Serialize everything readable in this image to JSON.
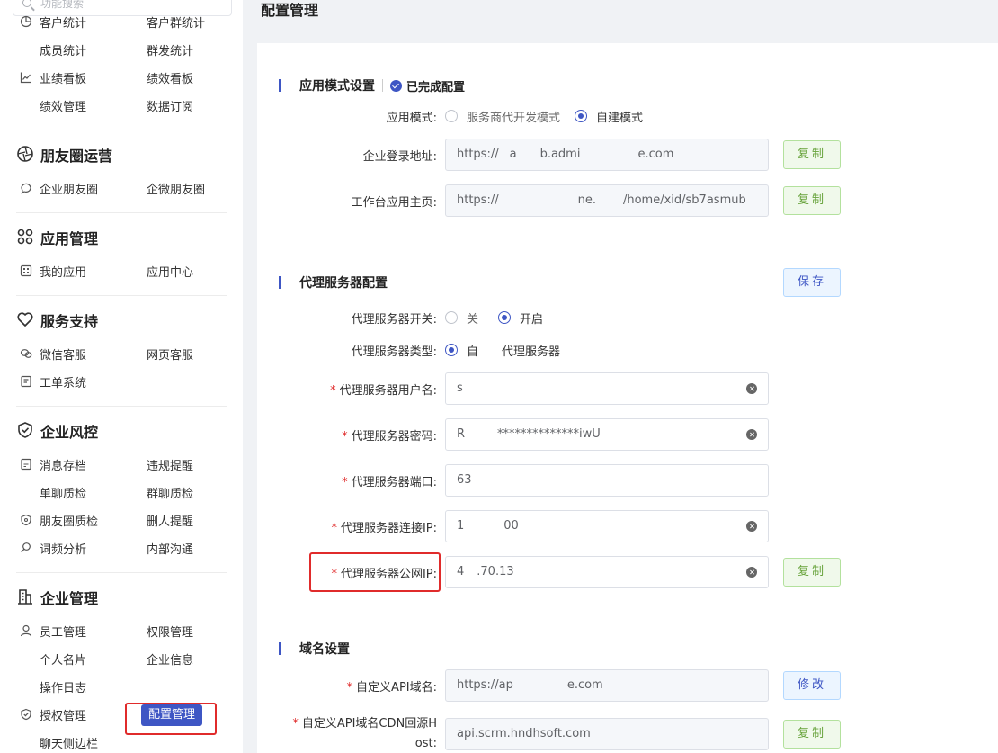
{
  "sidebar": {
    "search_placeholder": "功能搜索",
    "rows": [
      {
        "a": "客户统计",
        "b": "客户群统计"
      },
      {
        "a": "成员统计",
        "b": "群发统计"
      },
      {
        "a": "业绩看板",
        "b": "绩效看板"
      },
      {
        "a": "绩效管理",
        "b": "数据订阅"
      },
      {
        "a": "企业朋友圈",
        "b": "企微朋友圈"
      },
      {
        "a": "我的应用",
        "b": "应用中心"
      },
      {
        "a": "微信客服",
        "b": "网页客服"
      },
      {
        "a": "工单系统",
        "b": ""
      },
      {
        "a": "消息存档",
        "b": "违规提醒"
      },
      {
        "a": "单聊质检",
        "b": "群聊质检"
      },
      {
        "a": "朋友圈质检",
        "b": "删人提醒"
      },
      {
        "a": "词频分析",
        "b": "内部沟通"
      },
      {
        "a": "员工管理",
        "b": "权限管理"
      },
      {
        "a": "个人名片",
        "b": "企业信息"
      },
      {
        "a": "操作日志",
        "b": ""
      },
      {
        "a": "授权管理",
        "b": "配置管理"
      },
      {
        "a": "聊天侧边栏",
        "b": ""
      }
    ],
    "sections": {
      "moments": "朋友圈运营",
      "apps": "应用管理",
      "support": "服务支持",
      "risk": "企业风控",
      "enterprise": "企业管理"
    },
    "active_item": "配置管理"
  },
  "page": {
    "title": "配置管理"
  },
  "app_mode": {
    "title": "应用模式设置",
    "status": "已完成配置",
    "mode_label": "应用模式:",
    "mode_options": [
      "服务商代开发模式",
      "自建模式"
    ],
    "mode_selected": "自建模式",
    "login_label": "企业登录地址:",
    "login_value": "https://",
    "login_value_mid": "a",
    "login_value_mid2": "b.admi",
    "login_value_end": "e.com",
    "home_label": "工作台应用主页:",
    "home_value": "https://",
    "home_value_mid": "ne.",
    "home_value_end": "/home/xid/sb7asmub",
    "copy_label": "复制"
  },
  "proxy": {
    "title": "代理服务器配置",
    "save_label": "保存",
    "switch_label": "代理服务器开关:",
    "switch_off": "关",
    "switch_on": "开启",
    "type_label": "代理服务器类型:",
    "type_value_a": "自",
    "type_value_b": "代理服务器",
    "user_label": "代理服务器用户名:",
    "user_value": "s",
    "pass_label": "代理服务器密码:",
    "pass_value": "R",
    "pass_mask": "**************iwU",
    "port_label": "代理服务器端口:",
    "port_value": "63",
    "conn_ip_label": "代理服务器连接IP:",
    "conn_ip_value": "1",
    "conn_ip_end": "00",
    "pub_ip_label": "代理服务器公网IP:",
    "pub_ip_value": "4",
    "pub_ip_end": ".70.13",
    "copy_label": "复制"
  },
  "domain": {
    "title": "域名设置",
    "api_label": "自定义API域名:",
    "api_value": "https://ap",
    "api_value_end": "e.com",
    "edit_label": "修改",
    "cdn_label_l1": "自定义API域名CDN回源H",
    "cdn_label_l2": "ost:",
    "cdn_value": "api.scrm.hndhsoft.com",
    "copy_label": "复制"
  }
}
